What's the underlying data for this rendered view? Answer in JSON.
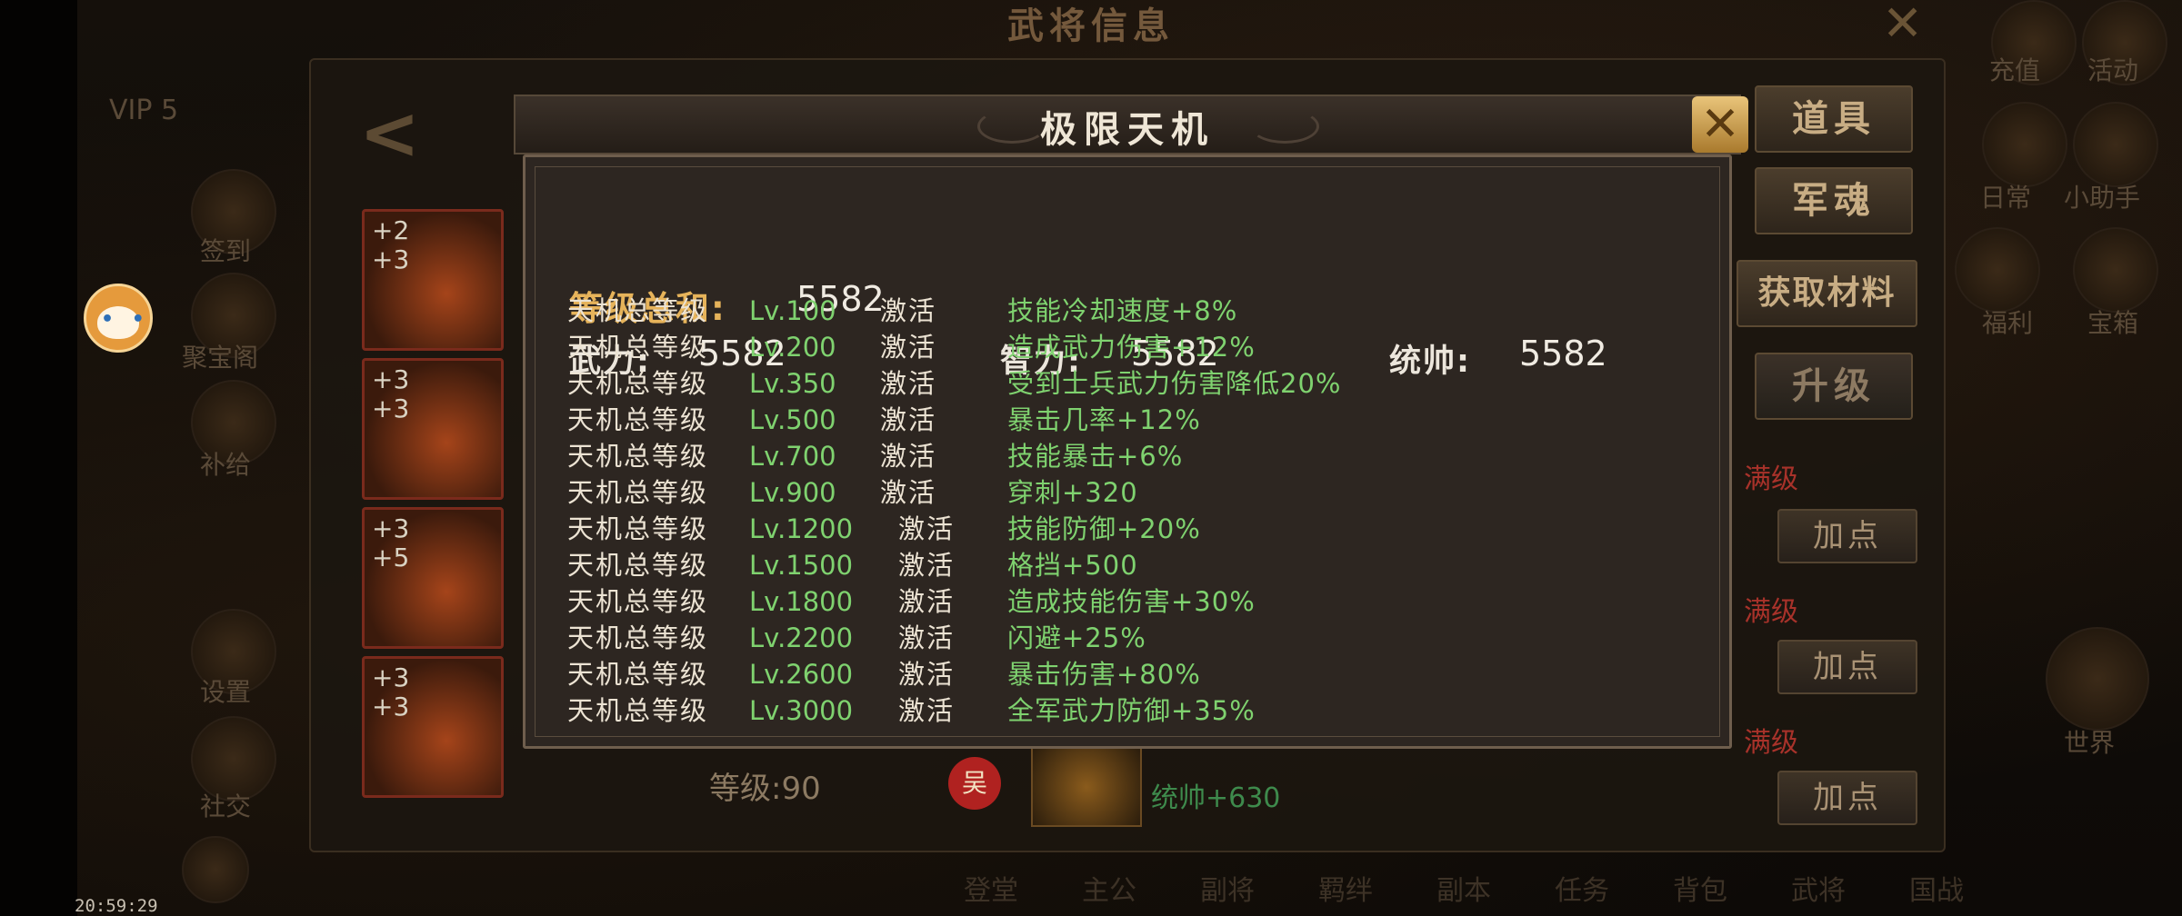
{
  "background": {
    "title": "武将信息",
    "vip": "VIP 5",
    "right_buttons": [
      "道具",
      "军魂",
      "获取材料",
      "升级"
    ],
    "max_label": "满级",
    "add_point_label": "加点",
    "left_menu": [
      "签到",
      "聚宝阁",
      "补给",
      "设置",
      "社交"
    ],
    "right_menu": [
      "充值",
      "活动",
      "日常",
      "小助手",
      "福利",
      "宝箱",
      "世界"
    ],
    "equip_slots": [
      {
        "top": "+2",
        "bottom": "+3"
      },
      {
        "top": "+3",
        "bottom": "+3"
      },
      {
        "top": "+3",
        "bottom": "+5"
      },
      {
        "top": "+3",
        "bottom": "+3"
      }
    ],
    "level_text": "等级:90",
    "wu_badge": "吴",
    "stat_bonus": "统帅+630",
    "bottom_tabs": [
      "登堂",
      "主公",
      "副将",
      "羁绊",
      "副本",
      "任务",
      "背包",
      "武将",
      "国战"
    ]
  },
  "status": {
    "clock": "20:59:29"
  },
  "modal": {
    "title": "极限天机",
    "total_label": "等级总和:",
    "total_value": "5582",
    "stats": [
      {
        "label": "武力:",
        "value": "5582"
      },
      {
        "label": "智力:",
        "value": "5582"
      },
      {
        "label": "统帅:",
        "value": "5582"
      }
    ],
    "row_prefix": "天机总等级",
    "activate_label": "激活",
    "rows": [
      {
        "level": "Lv.100",
        "effect": "技能冷却速度+8%"
      },
      {
        "level": "Lv.200",
        "effect": "造成武力伤害+12%"
      },
      {
        "level": "Lv.350",
        "effect": "受到士兵武力伤害降低20%"
      },
      {
        "level": "Lv.500",
        "effect": "暴击几率+12%"
      },
      {
        "level": "Lv.700",
        "effect": "技能暴击+6%"
      },
      {
        "level": "Lv.900",
        "effect": "穿刺+320"
      },
      {
        "level": "Lv.1200",
        "effect": "技能防御+20%"
      },
      {
        "level": "Lv.1500",
        "effect": "格挡+500"
      },
      {
        "level": "Lv.1800",
        "effect": "造成技能伤害+30%"
      },
      {
        "level": "Lv.2200",
        "effect": "闪避+25%"
      },
      {
        "level": "Lv.2600",
        "effect": "暴击伤害+80%"
      },
      {
        "level": "Lv.3000",
        "effect": "全军武力防御+35%"
      }
    ]
  }
}
